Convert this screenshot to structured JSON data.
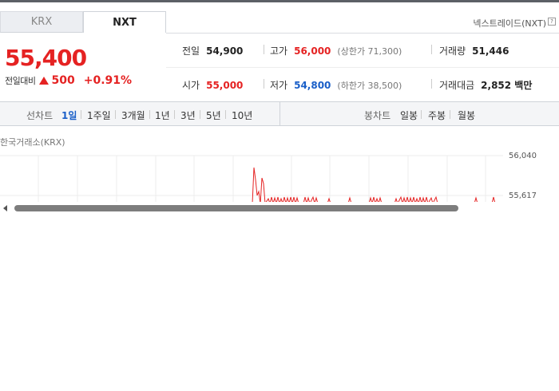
{
  "market_tabs": [
    {
      "label": "KRX",
      "active": false
    },
    {
      "label": "NXT",
      "active": true
    }
  ],
  "source_label": "넥스트레이드(NXT)",
  "help_icon": "?",
  "quote": {
    "price": "55,400",
    "change_label": "전일대비",
    "change_amount": "500",
    "change_direction_icon": "up-triangle-icon",
    "change_pct": "+0.91%"
  },
  "stats": {
    "prev_close": {
      "label": "전일",
      "value": "54,900"
    },
    "high": {
      "label": "고가",
      "value": "56,000",
      "sub": "(상한가 71,300)"
    },
    "volume": {
      "label": "거래량",
      "value": "51,446"
    },
    "open": {
      "label": "시가",
      "value": "55,000"
    },
    "low": {
      "label": "저가",
      "value": "54,800",
      "sub": "(하한가 38,500)"
    },
    "turnover": {
      "label": "거래대금",
      "value": "2,852 백만"
    }
  },
  "line_chart_tabs": {
    "label": "선차트",
    "items": [
      "1일",
      "1주일",
      "3개월",
      "1년",
      "3년",
      "5년",
      "10년"
    ],
    "active": "1일"
  },
  "candle_chart_tabs": {
    "label": "봉차트",
    "items": [
      "일봉",
      "주봉",
      "월봉"
    ]
  },
  "chart": {
    "title": "한국거래소(KRX)",
    "y_ticks": [
      "56,040",
      "55,617"
    ],
    "line_color": "#e52222"
  },
  "colors": {
    "up": "#e52222",
    "down": "#1a5fc8",
    "active_tab": "#1a5fc8"
  }
}
